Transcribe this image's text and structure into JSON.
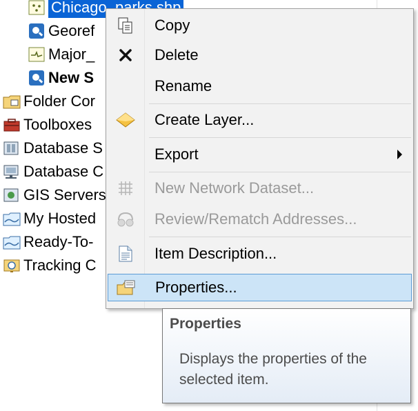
{
  "tree": {
    "children": [
      {
        "label": "Chicago_parks.shp",
        "icon": "point-shapefile-icon",
        "selected": true
      },
      {
        "label": "Georef",
        "icon": "globe-layer-icon"
      },
      {
        "label": "Major_",
        "icon": "line-shapefile-icon"
      },
      {
        "label": "New S",
        "icon": "globe-layer-icon",
        "bold": true
      }
    ],
    "roots": [
      {
        "label": "Folder Cor",
        "icon": "folder-connections-icon"
      },
      {
        "label": "Toolboxes",
        "icon": "toolbox-icon"
      },
      {
        "label": "Database S",
        "icon": "database-servers-icon"
      },
      {
        "label": "Database C",
        "icon": "database-connections-icon"
      },
      {
        "label": "GIS Servers",
        "icon": "gis-servers-icon"
      },
      {
        "label": "My Hosted",
        "icon": "folder-icon"
      },
      {
        "label": "Ready-To-",
        "icon": "folder-icon"
      },
      {
        "label": "Tracking C",
        "icon": "tracking-icon"
      }
    ]
  },
  "menu": {
    "items": [
      {
        "label": "Copy",
        "icon": "copy-icon",
        "enabled": true
      },
      {
        "label": "Delete",
        "icon": "delete-icon",
        "enabled": true
      },
      {
        "label": "Rename",
        "icon": "",
        "enabled": true
      },
      {
        "label": "Create Layer...",
        "icon": "layer-diamond-icon",
        "enabled": true
      },
      {
        "label": "Export",
        "icon": "",
        "enabled": true,
        "submenu": true
      },
      {
        "label": "New Network Dataset...",
        "icon": "network-dataset-icon",
        "enabled": false
      },
      {
        "label": "Review/Rematch Addresses...",
        "icon": "rematch-addresses-icon",
        "enabled": false
      },
      {
        "label": "Item Description...",
        "icon": "document-icon",
        "enabled": true
      },
      {
        "label": "Properties...",
        "icon": "properties-icon",
        "enabled": true,
        "hover": true
      }
    ]
  },
  "tooltip": {
    "title": "Properties",
    "description": "Displays the properties of the selected item."
  },
  "colors": {
    "selection": "#0a64d6",
    "menu_hover": "#cce4f7",
    "menu_hover_border": "#5b9bd5",
    "disabled_text": "#9a9a9a"
  }
}
